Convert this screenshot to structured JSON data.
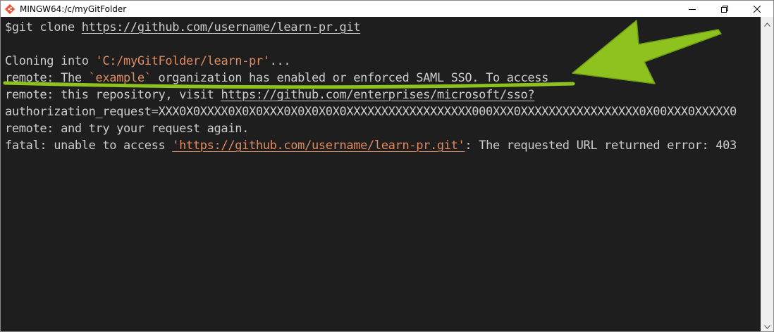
{
  "window": {
    "title": "MINGW64:/c/myGitFolder"
  },
  "terminal": {
    "cmd_prompt": "$git clone ",
    "cmd_url": "https://github.com/username/learn-pr.git",
    "clone_prefix": "Cloning into ",
    "clone_path": "'C:/myGitFolder/learn-pr'",
    "clone_suffix": "...",
    "remote1_prefix": "remote: The ",
    "remote1_org": "`example`",
    "remote1_suffix": " organization has enabled or enforced SAML SSO. To access",
    "remote2_prefix": "remote: this repository, visit ",
    "remote2_url": "https://github.com/enterprises/microsoft/sso?",
    "auth_line": "authorization_request=XXX0X0XXXX0X0X0XXX0X0X0X0X0XXXXXXXXXXXXXXXXXX000XXX0XXXXXXXXXXXXXXXXX0X00XXX0XXXXX0",
    "remote3": "remote: and try your request again.",
    "fatal_prefix": "fatal: unable to access ",
    "fatal_url": "'https://github.com/username/learn-pr.git'",
    "fatal_suffix": ": The requested URL returned error: 403"
  },
  "colors": {
    "terminal_bg": "#1e1e1e",
    "text": "#cccccc",
    "path_highlight": "#e08a60",
    "annotation_green": "#8dc21f"
  },
  "icons": {
    "app": "git-bash-icon",
    "minimize": "minimize-icon",
    "maximize": "restore-icon",
    "close": "close-icon"
  }
}
